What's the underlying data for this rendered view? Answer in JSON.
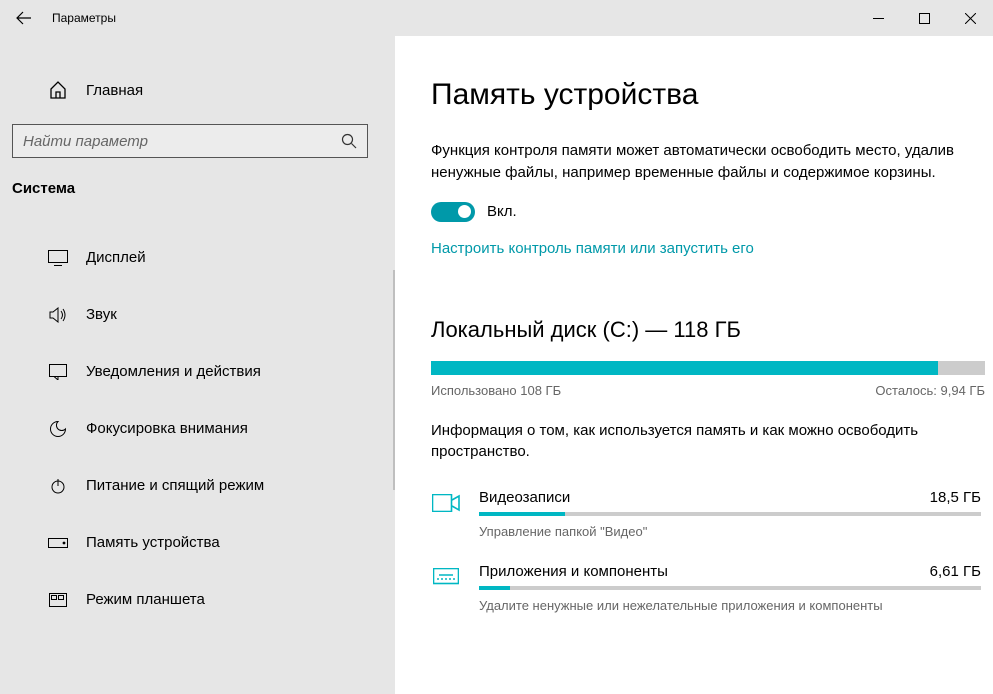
{
  "window": {
    "title": "Параметры"
  },
  "sidebar": {
    "home": "Главная",
    "search_placeholder": "Найти параметр",
    "category": "Система",
    "items": [
      {
        "label": "Дисплей"
      },
      {
        "label": "Звук"
      },
      {
        "label": "Уведомления и действия"
      },
      {
        "label": "Фокусировка внимания"
      },
      {
        "label": "Питание и спящий режим"
      },
      {
        "label": "Память устройства"
      },
      {
        "label": "Режим планшета"
      }
    ]
  },
  "content": {
    "heading": "Память устройства",
    "description": "Функция контроля памяти может автоматически освободить место, удалив ненужные файлы, например временные файлы и содержимое корзины.",
    "toggle_label": "Вкл.",
    "toggle_on": true,
    "configure_link": "Настроить контроль памяти или запустить его",
    "disk": {
      "title": "Локальный диск (C:) — 118 ГБ",
      "used_label": "Использовано 108 ГБ",
      "free_label": "Осталось: 9,94 ГБ",
      "fill_percent": 91.6,
      "info": "Информация о том, как используется память и как можно освободить пространство."
    },
    "categories": [
      {
        "name": "Видеозаписи",
        "size": "18,5 ГБ",
        "sub": "Управление папкой \"Видео\"",
        "percent": 17.1
      },
      {
        "name": "Приложения и компоненты",
        "size": "6,61 ГБ",
        "sub": "Удалите ненужные или нежелательные приложения и компоненты",
        "percent": 6.1
      }
    ]
  }
}
